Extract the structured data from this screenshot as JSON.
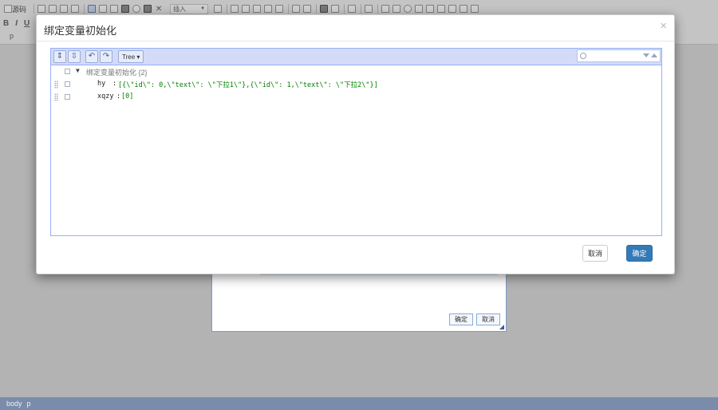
{
  "editor": {
    "source_label": "源码",
    "insert_select": "插入",
    "format_buttons": [
      "B",
      "I",
      "U"
    ],
    "path_text": "p"
  },
  "bg_dialog": {
    "ok_label": "确定",
    "cancel_label": "取消"
  },
  "status_bar": {
    "items": [
      "body",
      "p"
    ]
  },
  "modal": {
    "title": "绑定变量初始化",
    "close_glyph": "×",
    "json_editor": {
      "mode_label": "Tree ▾",
      "search_placeholder": "",
      "root": {
        "label": "绑定变量初始化 {2}",
        "expander": "▼"
      },
      "fields": [
        {
          "key": "hy",
          "colon": ":",
          "value": "[{\\\"id\\\": 0,\\\"text\\\": \\\"下拉1\\\"},{\\\"id\\\": 1,\\\"text\\\": \\\"下拉2\\\"}]"
        },
        {
          "key": "xqzy",
          "colon": ":",
          "value": "[0]"
        }
      ]
    },
    "footer": {
      "cancel_label": "取消",
      "ok_label": "确定"
    }
  },
  "colors": {
    "primary": "#337ab7",
    "value_green": "#008000",
    "menu_bg": "#d3dbf7",
    "status_bar": "#7b8cab"
  }
}
